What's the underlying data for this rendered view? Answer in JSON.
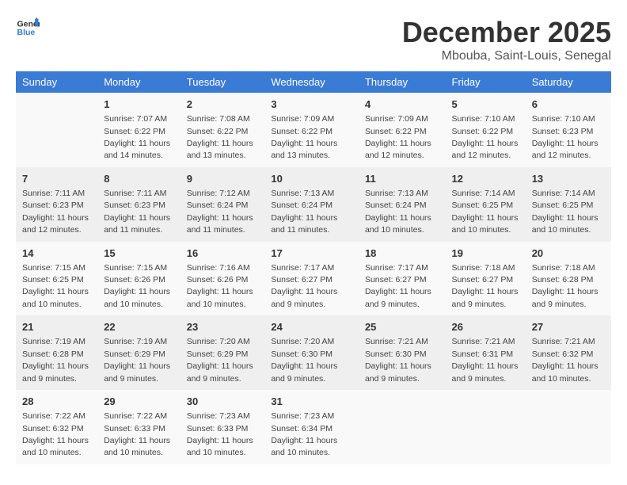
{
  "header": {
    "logo_general": "General",
    "logo_blue": "Blue",
    "title": "December 2025",
    "subtitle": "Mbouba, Saint-Louis, Senegal"
  },
  "days_of_week": [
    "Sunday",
    "Monday",
    "Tuesday",
    "Wednesday",
    "Thursday",
    "Friday",
    "Saturday"
  ],
  "weeks": [
    [
      {
        "day": "",
        "sunrise": "",
        "sunset": "",
        "daylight": ""
      },
      {
        "day": "1",
        "sunrise": "Sunrise: 7:07 AM",
        "sunset": "Sunset: 6:22 PM",
        "daylight": "Daylight: 11 hours and 14 minutes."
      },
      {
        "day": "2",
        "sunrise": "Sunrise: 7:08 AM",
        "sunset": "Sunset: 6:22 PM",
        "daylight": "Daylight: 11 hours and 13 minutes."
      },
      {
        "day": "3",
        "sunrise": "Sunrise: 7:09 AM",
        "sunset": "Sunset: 6:22 PM",
        "daylight": "Daylight: 11 hours and 13 minutes."
      },
      {
        "day": "4",
        "sunrise": "Sunrise: 7:09 AM",
        "sunset": "Sunset: 6:22 PM",
        "daylight": "Daylight: 11 hours and 12 minutes."
      },
      {
        "day": "5",
        "sunrise": "Sunrise: 7:10 AM",
        "sunset": "Sunset: 6:22 PM",
        "daylight": "Daylight: 11 hours and 12 minutes."
      },
      {
        "day": "6",
        "sunrise": "Sunrise: 7:10 AM",
        "sunset": "Sunset: 6:23 PM",
        "daylight": "Daylight: 11 hours and 12 minutes."
      }
    ],
    [
      {
        "day": "7",
        "sunrise": "Sunrise: 7:11 AM",
        "sunset": "Sunset: 6:23 PM",
        "daylight": "Daylight: 11 hours and 12 minutes."
      },
      {
        "day": "8",
        "sunrise": "Sunrise: 7:11 AM",
        "sunset": "Sunset: 6:23 PM",
        "daylight": "Daylight: 11 hours and 11 minutes."
      },
      {
        "day": "9",
        "sunrise": "Sunrise: 7:12 AM",
        "sunset": "Sunset: 6:24 PM",
        "daylight": "Daylight: 11 hours and 11 minutes."
      },
      {
        "day": "10",
        "sunrise": "Sunrise: 7:13 AM",
        "sunset": "Sunset: 6:24 PM",
        "daylight": "Daylight: 11 hours and 11 minutes."
      },
      {
        "day": "11",
        "sunrise": "Sunrise: 7:13 AM",
        "sunset": "Sunset: 6:24 PM",
        "daylight": "Daylight: 11 hours and 10 minutes."
      },
      {
        "day": "12",
        "sunrise": "Sunrise: 7:14 AM",
        "sunset": "Sunset: 6:25 PM",
        "daylight": "Daylight: 11 hours and 10 minutes."
      },
      {
        "day": "13",
        "sunrise": "Sunrise: 7:14 AM",
        "sunset": "Sunset: 6:25 PM",
        "daylight": "Daylight: 11 hours and 10 minutes."
      }
    ],
    [
      {
        "day": "14",
        "sunrise": "Sunrise: 7:15 AM",
        "sunset": "Sunset: 6:25 PM",
        "daylight": "Daylight: 11 hours and 10 minutes."
      },
      {
        "day": "15",
        "sunrise": "Sunrise: 7:15 AM",
        "sunset": "Sunset: 6:26 PM",
        "daylight": "Daylight: 11 hours and 10 minutes."
      },
      {
        "day": "16",
        "sunrise": "Sunrise: 7:16 AM",
        "sunset": "Sunset: 6:26 PM",
        "daylight": "Daylight: 11 hours and 10 minutes."
      },
      {
        "day": "17",
        "sunrise": "Sunrise: 7:17 AM",
        "sunset": "Sunset: 6:27 PM",
        "daylight": "Daylight: 11 hours and 9 minutes."
      },
      {
        "day": "18",
        "sunrise": "Sunrise: 7:17 AM",
        "sunset": "Sunset: 6:27 PM",
        "daylight": "Daylight: 11 hours and 9 minutes."
      },
      {
        "day": "19",
        "sunrise": "Sunrise: 7:18 AM",
        "sunset": "Sunset: 6:27 PM",
        "daylight": "Daylight: 11 hours and 9 minutes."
      },
      {
        "day": "20",
        "sunrise": "Sunrise: 7:18 AM",
        "sunset": "Sunset: 6:28 PM",
        "daylight": "Daylight: 11 hours and 9 minutes."
      }
    ],
    [
      {
        "day": "21",
        "sunrise": "Sunrise: 7:19 AM",
        "sunset": "Sunset: 6:28 PM",
        "daylight": "Daylight: 11 hours and 9 minutes."
      },
      {
        "day": "22",
        "sunrise": "Sunrise: 7:19 AM",
        "sunset": "Sunset: 6:29 PM",
        "daylight": "Daylight: 11 hours and 9 minutes."
      },
      {
        "day": "23",
        "sunrise": "Sunrise: 7:20 AM",
        "sunset": "Sunset: 6:29 PM",
        "daylight": "Daylight: 11 hours and 9 minutes."
      },
      {
        "day": "24",
        "sunrise": "Sunrise: 7:20 AM",
        "sunset": "Sunset: 6:30 PM",
        "daylight": "Daylight: 11 hours and 9 minutes."
      },
      {
        "day": "25",
        "sunrise": "Sunrise: 7:21 AM",
        "sunset": "Sunset: 6:30 PM",
        "daylight": "Daylight: 11 hours and 9 minutes."
      },
      {
        "day": "26",
        "sunrise": "Sunrise: 7:21 AM",
        "sunset": "Sunset: 6:31 PM",
        "daylight": "Daylight: 11 hours and 9 minutes."
      },
      {
        "day": "27",
        "sunrise": "Sunrise: 7:21 AM",
        "sunset": "Sunset: 6:32 PM",
        "daylight": "Daylight: 11 hours and 10 minutes."
      }
    ],
    [
      {
        "day": "28",
        "sunrise": "Sunrise: 7:22 AM",
        "sunset": "Sunset: 6:32 PM",
        "daylight": "Daylight: 11 hours and 10 minutes."
      },
      {
        "day": "29",
        "sunrise": "Sunrise: 7:22 AM",
        "sunset": "Sunset: 6:33 PM",
        "daylight": "Daylight: 11 hours and 10 minutes."
      },
      {
        "day": "30",
        "sunrise": "Sunrise: 7:23 AM",
        "sunset": "Sunset: 6:33 PM",
        "daylight": "Daylight: 11 hours and 10 minutes."
      },
      {
        "day": "31",
        "sunrise": "Sunrise: 7:23 AM",
        "sunset": "Sunset: 6:34 PM",
        "daylight": "Daylight: 11 hours and 10 minutes."
      },
      {
        "day": "",
        "sunrise": "",
        "sunset": "",
        "daylight": ""
      },
      {
        "day": "",
        "sunrise": "",
        "sunset": "",
        "daylight": ""
      },
      {
        "day": "",
        "sunrise": "",
        "sunset": "",
        "daylight": ""
      }
    ]
  ]
}
